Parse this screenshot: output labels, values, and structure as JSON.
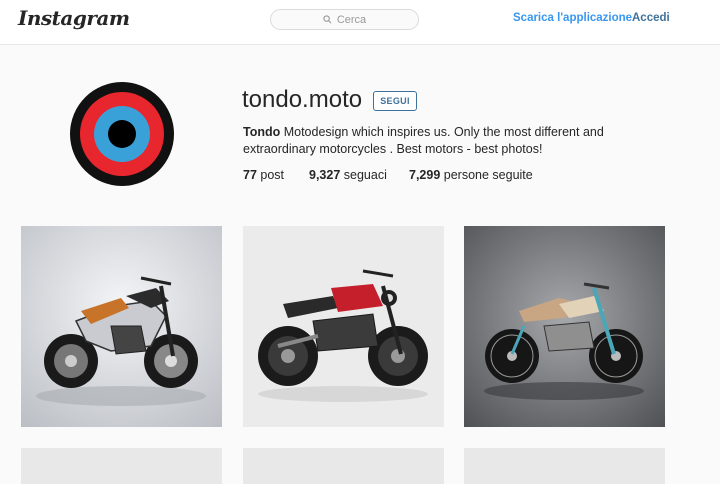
{
  "header": {
    "logo_text": "Instagram",
    "search_placeholder": "Cerca",
    "app_link": "Scarica l'applicazione",
    "login_link": "Accedi"
  },
  "profile": {
    "username": "tondo.moto",
    "follow_label": "SEGUI",
    "bio_name": "Tondo",
    "bio_text": " Motodesign which inspires us. Only the most different and extraordinary motorcycles . Best motors - best photos!",
    "stats": [
      {
        "value": "77",
        "label": "post"
      },
      {
        "value": "9,327",
        "label": "seguaci"
      },
      {
        "value": "7,299",
        "label": "persone seguite"
      }
    ]
  },
  "colors": {
    "link_blue": "#3897f0",
    "brand_blue": "#3f729b",
    "avatar_rings": [
      "#111111",
      "#e8262d",
      "#3aa0d8",
      "#000000"
    ]
  },
  "posts": [
    {
      "subject": "silver-orange-superbike"
    },
    {
      "subject": "red-scrambler-motorcycle"
    },
    {
      "subject": "teal-cafe-racer"
    }
  ]
}
